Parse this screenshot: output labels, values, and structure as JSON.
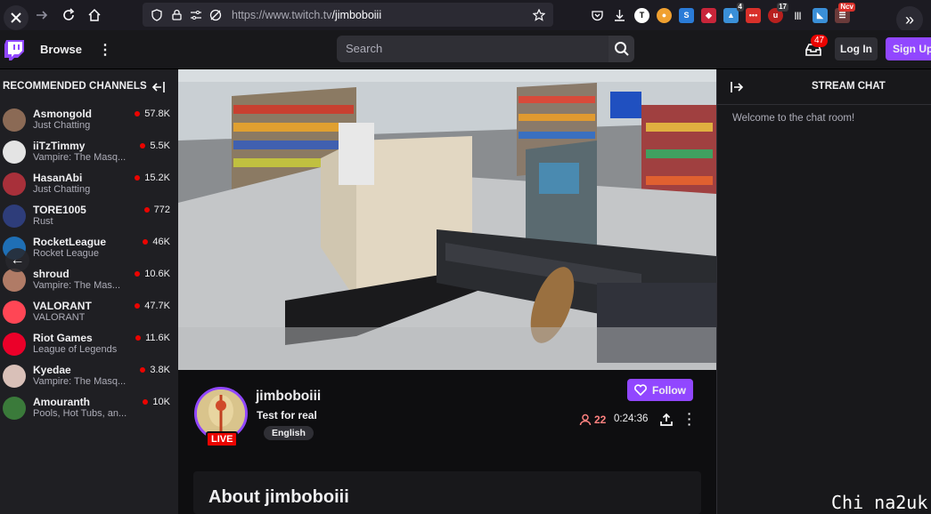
{
  "browser": {
    "url_host": "https://www.twitch.tv",
    "url_path": "/jimboboiii",
    "extension_badges": [
      "4",
      "17",
      "Ncv"
    ]
  },
  "topnav": {
    "browse": "Browse",
    "search_placeholder": "Search",
    "inbox_count": "47",
    "login": "Log In",
    "signup": "Sign Up"
  },
  "sidebar": {
    "heading": "RECOMMENDED CHANNELS",
    "channels": [
      {
        "name": "Asmongold",
        "game": "Just Chatting",
        "viewers": "57.8K",
        "color": "#8b6a55"
      },
      {
        "name": "iiTzTimmy",
        "game": "Vampire: The Masq...",
        "viewers": "5.5K",
        "color": "#e4e4e4"
      },
      {
        "name": "HasanAbi",
        "game": "Just Chatting",
        "viewers": "15.2K",
        "color": "#a8303a"
      },
      {
        "name": "TORE1005",
        "game": "Rust",
        "viewers": "772",
        "color": "#2e3d7a"
      },
      {
        "name": "RocketLeague",
        "game": "Rocket League",
        "viewers": "46K",
        "color": "#1f6fb5"
      },
      {
        "name": "shroud",
        "game": "Vampire: The Mas...",
        "viewers": "10.6K",
        "color": "#b07b66"
      },
      {
        "name": "VALORANT",
        "game": "VALORANT",
        "viewers": "47.7K",
        "color": "#ff4655"
      },
      {
        "name": "Riot Games",
        "game": "League of Legends",
        "viewers": "11.6K",
        "color": "#eb0029"
      },
      {
        "name": "Kyedae",
        "game": "Vampire: The Masq...",
        "viewers": "3.8K",
        "color": "#d9c0b8"
      },
      {
        "name": "Amouranth",
        "game": "Pools, Hot Tubs, an...",
        "viewers": "10K",
        "color": "#3a7a3a"
      }
    ]
  },
  "stream": {
    "streamer": "jimboboiii",
    "title": "Test for real",
    "tag": "English",
    "live_label": "LIVE",
    "follow": "Follow",
    "viewers": "22",
    "uptime": "0:24:36",
    "about": "About jimboboiii"
  },
  "chat": {
    "title": "STREAM CHAT",
    "welcome": "Welcome to the chat room!"
  },
  "watermark": "Chi na2uk",
  "colors": {
    "accent": "#9147ff",
    "live": "#eb0400"
  }
}
